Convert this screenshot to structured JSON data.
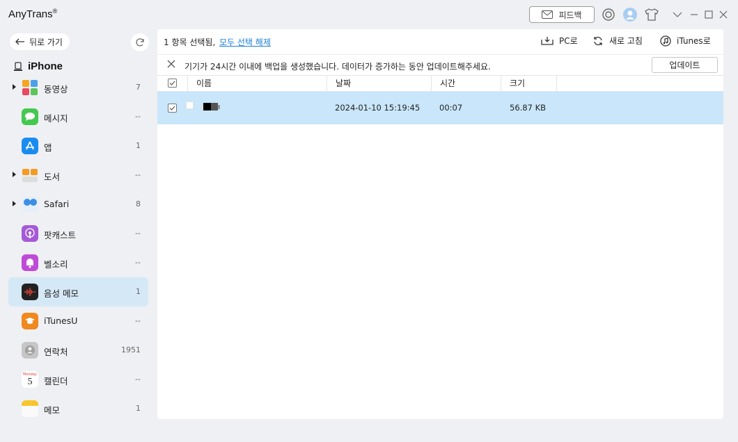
{
  "app": {
    "title": "AnyTrans",
    "mark": "®"
  },
  "titlebar": {
    "feedback_label": "피드백"
  },
  "sidebar": {
    "back_label": "뒤로 가기",
    "device_name": "iPhone",
    "items": [
      {
        "label": "동영상",
        "count": "7",
        "expandable": true,
        "icon": "video-icon",
        "color": "#f5a623"
      },
      {
        "label": "메시지",
        "count": "--",
        "expandable": false,
        "icon": "messages-icon",
        "color": "#45c84f"
      },
      {
        "label": "앱",
        "count": "1",
        "expandable": false,
        "icon": "app-store-icon",
        "color": "#1a8cf0"
      },
      {
        "label": "도서",
        "count": "--",
        "expandable": true,
        "icon": "books-icon",
        "color": "#f59a23"
      },
      {
        "label": "Safari",
        "count": "8",
        "expandable": true,
        "icon": "safari-icon",
        "color": "#3a8ee6"
      },
      {
        "label": "팟캐스트",
        "count": "--",
        "expandable": false,
        "icon": "podcast-icon",
        "color": "#a55ad6"
      },
      {
        "label": "벨소리",
        "count": "--",
        "expandable": false,
        "icon": "bell-icon",
        "color": "#c04ad8"
      },
      {
        "label": "음성 메모",
        "count": "1",
        "expandable": false,
        "icon": "voice-memo-icon",
        "color": "#222222",
        "active": true
      },
      {
        "label": "iTunesU",
        "count": "--",
        "expandable": false,
        "icon": "itunesu-icon",
        "color": "#f0891e"
      },
      {
        "label": "연락처",
        "count": "1951",
        "expandable": false,
        "icon": "contacts-icon",
        "color": "#b8b8b8"
      },
      {
        "label": "캘린더",
        "count": "--",
        "expandable": false,
        "icon": "calendar-icon",
        "color": "#ffffff"
      },
      {
        "label": "메모",
        "count": "1",
        "expandable": false,
        "icon": "notes-icon",
        "color": "#f7c52e"
      }
    ],
    "calendar_day": "5",
    "calendar_weekday": "Monday"
  },
  "toolbar": {
    "selection_text": "1 항목 선택됨,",
    "deselect_label": "모두 선택 해제",
    "to_pc_label": "PC로",
    "refresh_label": "새로 고침",
    "to_itunes_label": "iTunes로"
  },
  "notice": {
    "text": "기기가 24시간 이내에 백업을 생성했습니다. 데이터가 증가하는 동안 업데이트해주세요.",
    "update_label": "업데이트"
  },
  "table": {
    "columns": [
      "이름",
      "날짜",
      "시간",
      "크기"
    ],
    "rows": [
      {
        "date": "2024-01-10 15:19:45",
        "duration": "00:07",
        "size": "56.87 KB",
        "selected": true
      }
    ]
  },
  "colors": {
    "accent": "#1d7fd6",
    "selected_row": "#c9e6fa",
    "active_sidebar": "#d5e8f6"
  }
}
